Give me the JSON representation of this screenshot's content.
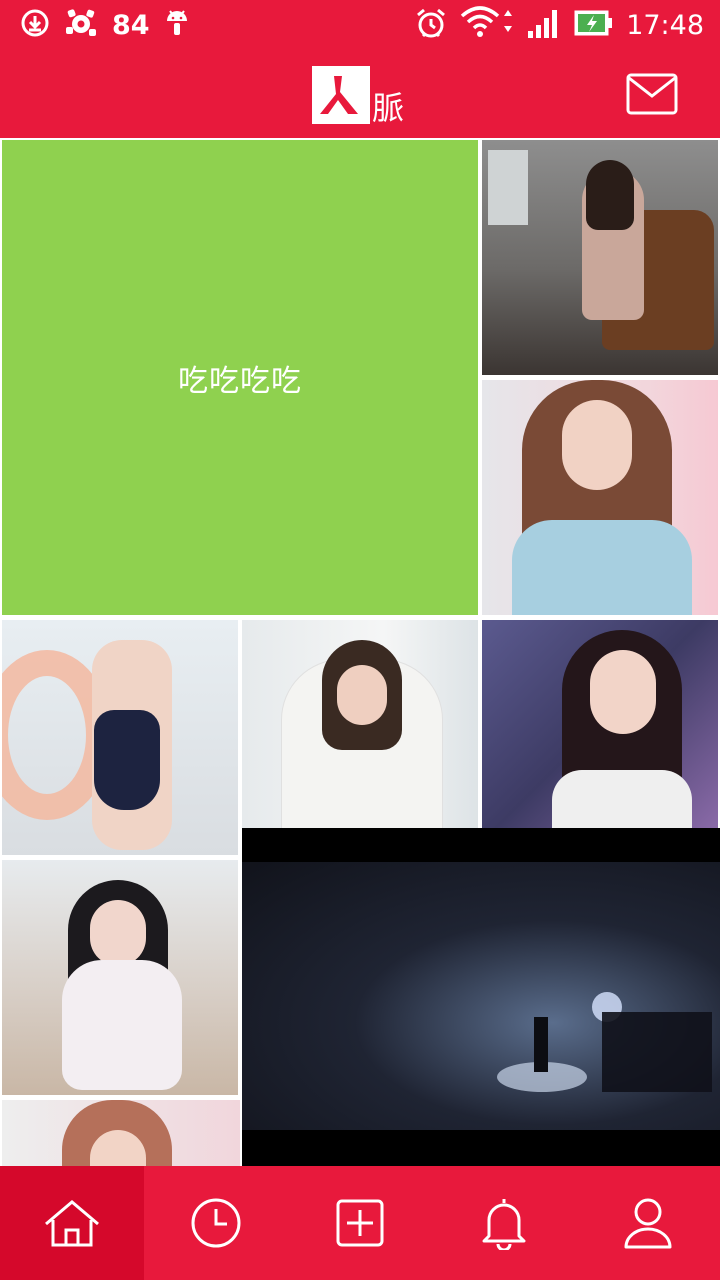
{
  "status_bar": {
    "notification_count": "84",
    "time": "17:48"
  },
  "header": {
    "logo_text": "脈",
    "logo_glyph": "人",
    "mail_icon": "mail-icon"
  },
  "feed": {
    "text_post": "吃吃吃吃"
  },
  "bottom_nav": {
    "items": [
      {
        "name": "home",
        "icon": "home-icon",
        "active": true
      },
      {
        "name": "recent",
        "icon": "clock-icon",
        "active": false
      },
      {
        "name": "add",
        "icon": "plus-square-icon",
        "active": false
      },
      {
        "name": "notifications",
        "icon": "bell-icon",
        "active": false
      },
      {
        "name": "profile",
        "icon": "user-icon",
        "active": false
      }
    ]
  },
  "colors": {
    "brand_red": "#e8193c",
    "active_nav": "#d5082b",
    "text_tile_green": "#8fd14f"
  }
}
